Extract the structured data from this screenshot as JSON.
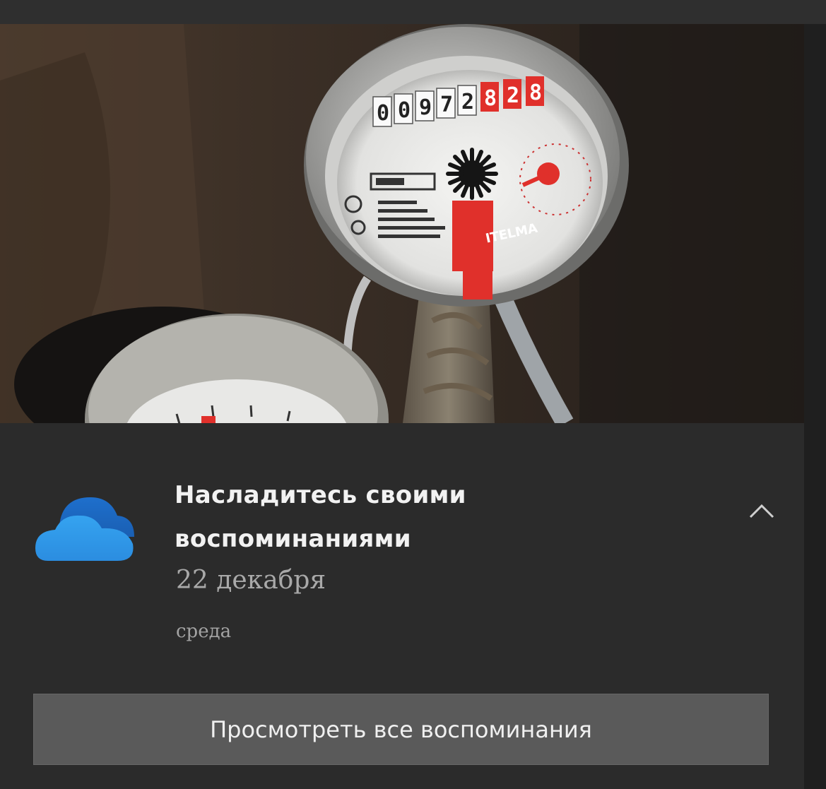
{
  "notification": {
    "app_icon": "onedrive-cloud-icon",
    "title": "Насладитесь своими воспоминаниями",
    "date": "22 декабря",
    "weekday": "среда",
    "collapse_icon": "chevron-up-icon",
    "action_label": "Просмотреть все воспоминания"
  },
  "photo": {
    "meter_brand": "ITELMA",
    "meter_digits": [
      "0",
      "0",
      "9",
      "7",
      "2",
      "8",
      "2",
      "8"
    ]
  },
  "colors": {
    "toast_background": "#2b2b2b",
    "button_background": "#5a5a5a",
    "onedrive_blue": "#2b8de0",
    "meter_red": "#e0302b"
  }
}
